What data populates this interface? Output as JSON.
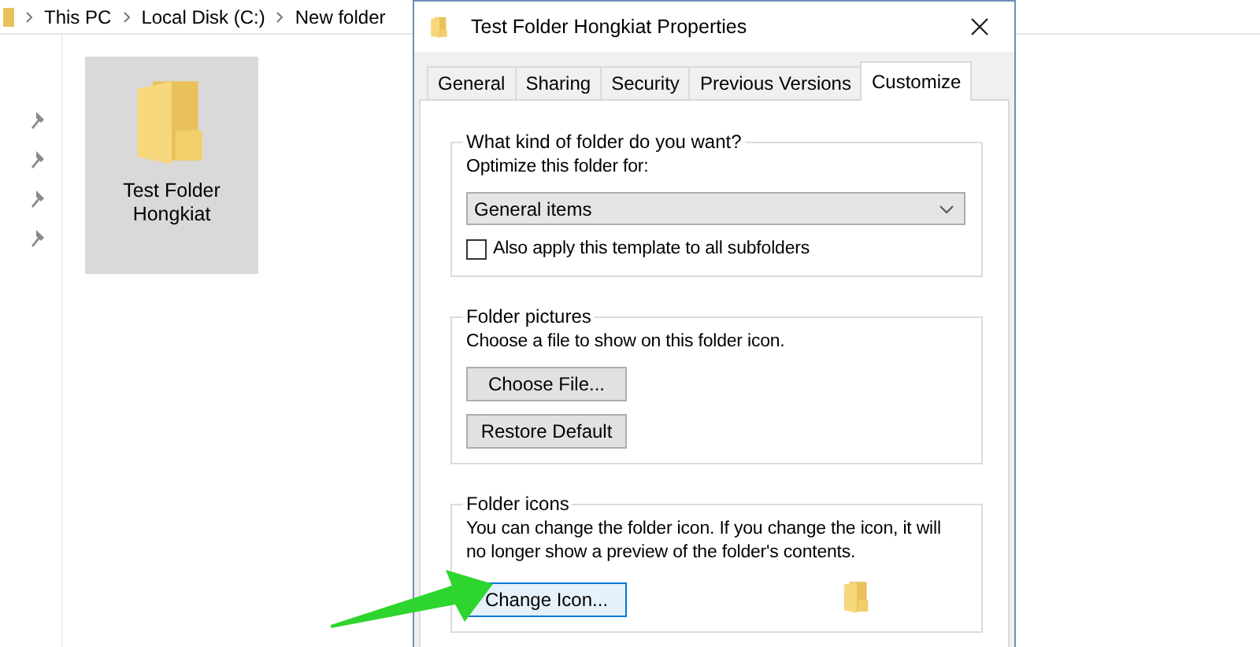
{
  "explorer": {
    "breadcrumb": [
      "This PC",
      "Local Disk (C:)",
      "New folder"
    ],
    "items": [
      {
        "label": "Test Folder Hongkiat",
        "selected": true
      }
    ]
  },
  "dialog": {
    "title": "Test Folder Hongkiat Properties",
    "tabs": [
      {
        "label": "General",
        "selected": false
      },
      {
        "label": "Sharing",
        "selected": false
      },
      {
        "label": "Security",
        "selected": false
      },
      {
        "label": "Previous Versions",
        "selected": false
      },
      {
        "label": "Customize",
        "selected": true
      }
    ],
    "folder_type": {
      "title": "What kind of folder do you want?",
      "label": "Optimize this folder for:",
      "dropdown": {
        "value": "General items"
      },
      "checkbox": {
        "label": "Also apply this template to all subfolders",
        "checked": false
      }
    },
    "folder_pictures": {
      "title": "Folder pictures",
      "text": "Choose a file to show on this folder icon.",
      "buttons": [
        {
          "label": "Choose File...",
          "focused": false
        },
        {
          "label": "Restore Default",
          "focused": false
        }
      ]
    },
    "folder_icons": {
      "title": "Folder icons",
      "text": "You can change the folder icon. If you change the icon, it will no longer show a preview of the folder's contents.",
      "buttons": [
        {
          "label": "Change Icon...",
          "focused": true
        }
      ]
    }
  }
}
